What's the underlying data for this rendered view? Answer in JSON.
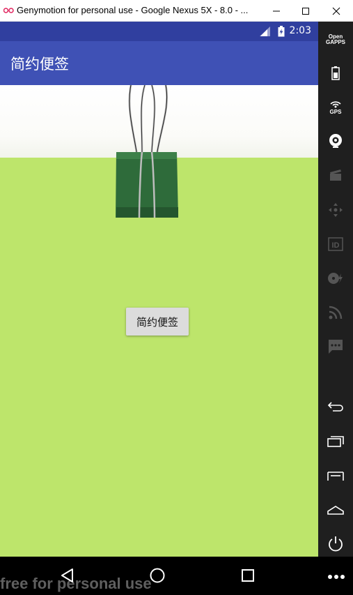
{
  "window": {
    "title": "Genymotion for personal use - Google Nexus 5X - 8.0 - ...",
    "logo_icon": "genymotion-logo-icon",
    "minimize_icon": "minimize-icon",
    "maximize_icon": "maximize-icon",
    "close_icon": "close-icon"
  },
  "status_bar": {
    "time": "2:03",
    "icons": [
      "signal-icon",
      "battery-icon"
    ]
  },
  "app_bar": {
    "title": "简约便签"
  },
  "main": {
    "button_label": "简约便签",
    "image": "binder-clip-icon"
  },
  "nav_bar": {
    "back_icon": "back-triangle-icon",
    "home_icon": "home-circle-icon",
    "recent_icon": "recent-apps-icon",
    "watermark": "free for personal use",
    "more_icon": "more-dots-icon"
  },
  "sidebar": {
    "items": [
      {
        "name": "opengapps-button",
        "label_line1": "Open",
        "label_line2": "GAPPS"
      },
      {
        "name": "battery-tool-icon"
      },
      {
        "name": "gps-icon",
        "label": "GPS"
      },
      {
        "name": "webcam-icon"
      },
      {
        "name": "screencast-icon"
      },
      {
        "name": "dpad-icon"
      },
      {
        "name": "id-icon",
        "label": "ID"
      },
      {
        "name": "disk-io-icon"
      },
      {
        "name": "network-icon"
      },
      {
        "name": "sms-icon"
      },
      {
        "name": "back-icon"
      },
      {
        "name": "recent-icon"
      },
      {
        "name": "menu-icon"
      },
      {
        "name": "home-icon"
      },
      {
        "name": "power-icon"
      }
    ]
  },
  "colors": {
    "status_bar": "#303f9f",
    "app_bar": "#3f51b5",
    "paper_green": "#bde56b",
    "sidebar_bg": "#1f1f1f"
  }
}
